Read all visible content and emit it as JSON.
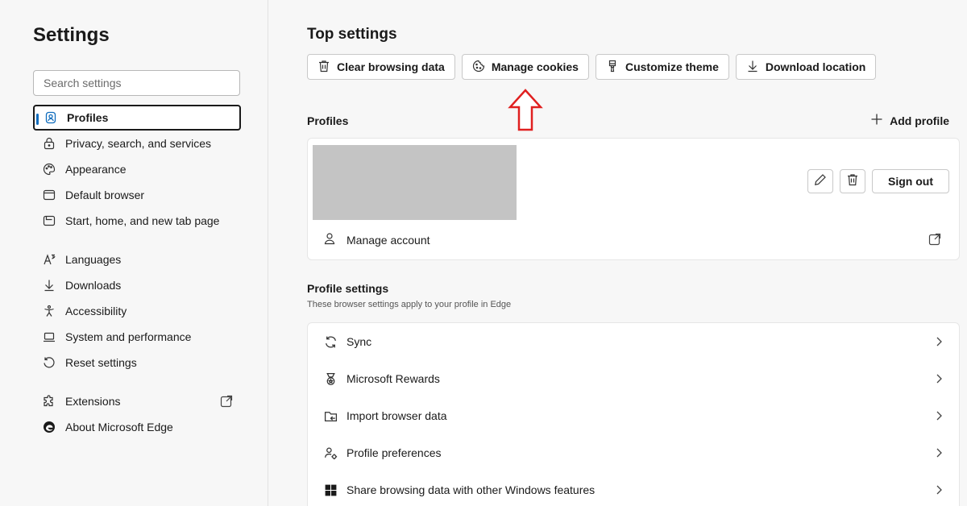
{
  "sidebar": {
    "title": "Settings",
    "search_placeholder": "Search settings",
    "items": [
      {
        "label": "Profiles",
        "icon": "profile-icon",
        "active": true
      },
      {
        "label": "Privacy, search, and services",
        "icon": "lock-icon"
      },
      {
        "label": "Appearance",
        "icon": "palette-icon"
      },
      {
        "label": "Default browser",
        "icon": "browser-icon"
      },
      {
        "label": "Start, home, and new tab page",
        "icon": "home-tab-icon"
      },
      {
        "label": "Languages",
        "icon": "languages-icon"
      },
      {
        "label": "Downloads",
        "icon": "download-icon"
      },
      {
        "label": "Accessibility",
        "icon": "accessibility-icon"
      },
      {
        "label": "System and performance",
        "icon": "laptop-icon"
      },
      {
        "label": "Reset settings",
        "icon": "reset-icon"
      },
      {
        "label": "Extensions",
        "icon": "puzzle-icon"
      },
      {
        "label": "About Microsoft Edge",
        "icon": "edge-logo-icon"
      }
    ]
  },
  "main": {
    "top_settings_title": "Top settings",
    "top_buttons": [
      {
        "label": "Clear browsing data",
        "icon": "trash-icon"
      },
      {
        "label": "Manage cookies",
        "icon": "cookie-icon"
      },
      {
        "label": "Customize theme",
        "icon": "brush-icon"
      },
      {
        "label": "Download location",
        "icon": "download-icon"
      }
    ],
    "profiles_label": "Profiles",
    "add_profile": "Add profile",
    "profile_card": {
      "sign_out": "Sign out",
      "manage_account": "Manage account"
    },
    "profile_settings": {
      "title": "Profile settings",
      "subtitle": "These browser settings apply to your profile in Edge",
      "rows": [
        {
          "label": "Sync",
          "icon": "sync-icon"
        },
        {
          "label": "Microsoft Rewards",
          "icon": "rewards-icon"
        },
        {
          "label": "Import browser data",
          "icon": "import-icon"
        },
        {
          "label": "Profile preferences",
          "icon": "profile-preferences-icon"
        },
        {
          "label": "Share browsing data with other Windows features",
          "icon": "windows-icon"
        }
      ]
    }
  },
  "colors": {
    "accent": "#0f6cbd",
    "annotation_arrow": "#e02020"
  }
}
